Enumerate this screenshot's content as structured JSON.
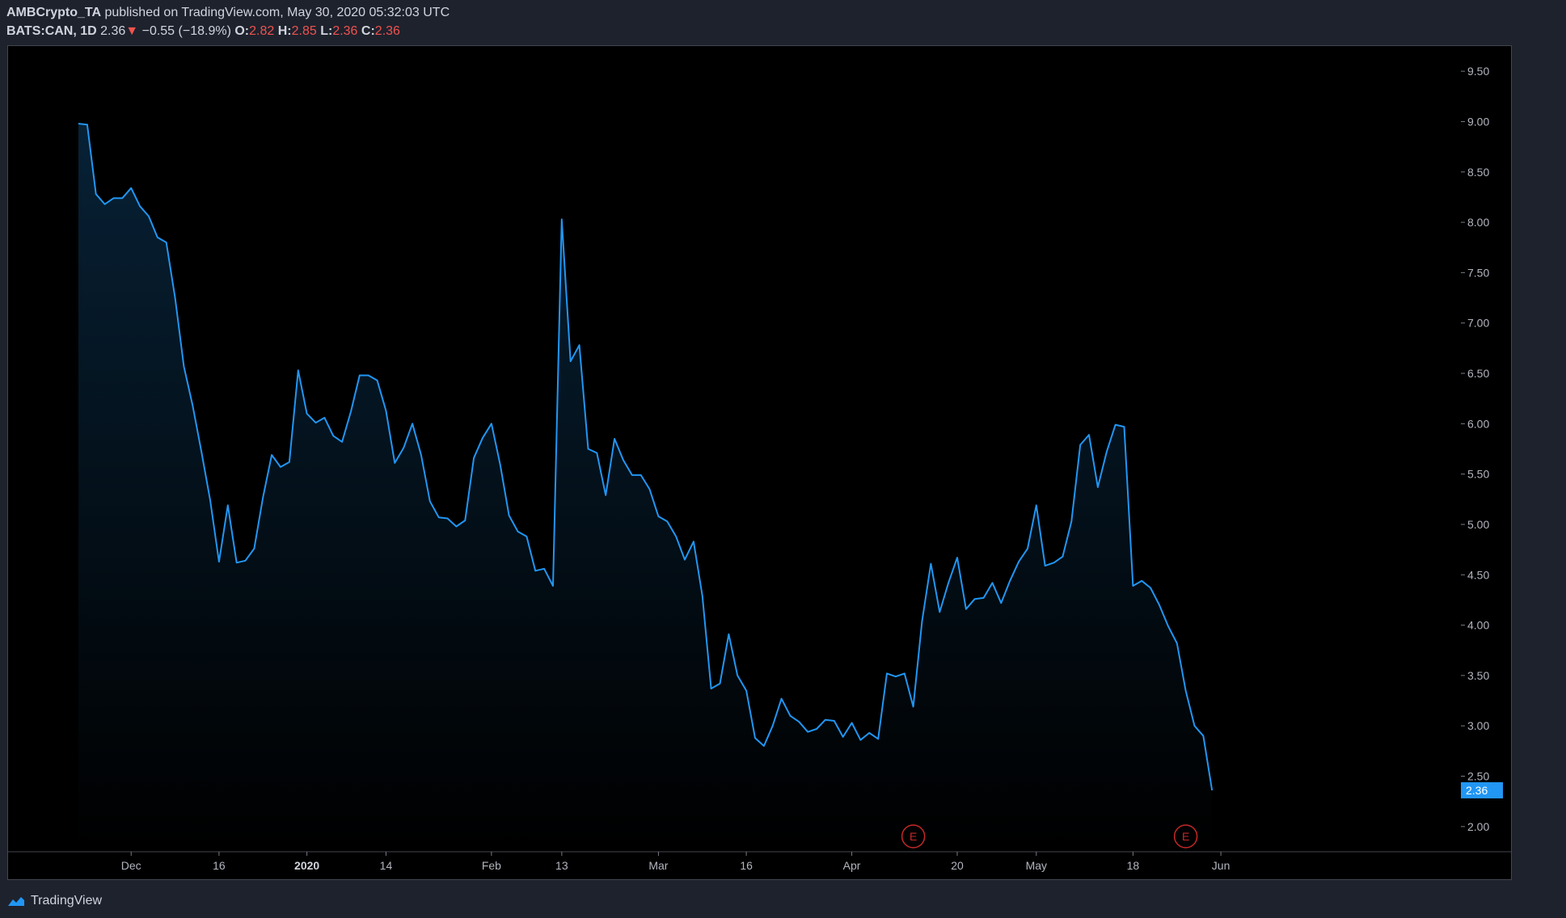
{
  "header": {
    "author": "AMBCrypto_TA",
    "published_text": "published on TradingView.com, May 30, 2020 05:32:03 UTC",
    "symbol": "BATS:CAN, 1D",
    "last_price": "2.36",
    "down_arrow": "▼",
    "change": "−0.55 (−18.9%)",
    "open_label": "O:",
    "open_value": "2.82",
    "high_label": "H:",
    "high_value": "2.85",
    "low_label": "L:",
    "low_value": "2.36",
    "close_label": "C:",
    "close_value": "2.36"
  },
  "footer": {
    "brand": "TradingView"
  },
  "colors": {
    "line": "#2196f3",
    "negative": "#ef5350",
    "earnings": "#c62828",
    "price_tag": "#2196f3",
    "axis_text": "#b2b5be",
    "background": "#000000"
  },
  "chart_data": {
    "type": "area",
    "ylim": [
      1.75,
      9.75
    ],
    "y_ticks": [
      "9.50",
      "9.00",
      "8.50",
      "8.00",
      "7.50",
      "7.00",
      "6.50",
      "6.00",
      "5.50",
      "5.00",
      "4.50",
      "4.00",
      "3.50",
      "3.00",
      "2.50",
      "2.00"
    ],
    "x_ticks": [
      {
        "label": "Dec",
        "index": 6,
        "bold": false
      },
      {
        "label": "16",
        "index": 16,
        "bold": false
      },
      {
        "label": "2020",
        "index": 26,
        "bold": true
      },
      {
        "label": "14",
        "index": 35,
        "bold": false
      },
      {
        "label": "Feb",
        "index": 47,
        "bold": false
      },
      {
        "label": "13",
        "index": 55,
        "bold": false
      },
      {
        "label": "Mar",
        "index": 66,
        "bold": false
      },
      {
        "label": "16",
        "index": 76,
        "bold": false
      },
      {
        "label": "Apr",
        "index": 88,
        "bold": false
      },
      {
        "label": "20",
        "index": 100,
        "bold": false
      },
      {
        "label": "May",
        "index": 109,
        "bold": false
      },
      {
        "label": "18",
        "index": 120,
        "bold": false
      },
      {
        "label": "Jun",
        "index": 130,
        "bold": false
      }
    ],
    "values": [
      8.98,
      8.97,
      8.28,
      8.18,
      8.24,
      8.24,
      8.34,
      8.16,
      8.06,
      7.85,
      7.8,
      7.25,
      6.57,
      6.18,
      5.72,
      5.24,
      4.63,
      5.19,
      4.62,
      4.64,
      4.76,
      5.27,
      5.69,
      5.57,
      5.62,
      6.53,
      6.1,
      6.01,
      6.06,
      5.88,
      5.82,
      6.12,
      6.48,
      6.48,
      6.43,
      6.13,
      5.61,
      5.76,
      6.0,
      5.69,
      5.23,
      5.07,
      5.06,
      4.98,
      5.04,
      5.66,
      5.86,
      6.0,
      5.59,
      5.09,
      4.93,
      4.88,
      4.54,
      4.56,
      4.39,
      8.03,
      6.62,
      6.78,
      5.75,
      5.71,
      5.29,
      5.85,
      5.64,
      5.49,
      5.49,
      5.35,
      5.08,
      5.03,
      4.88,
      4.65,
      4.83,
      4.29,
      3.37,
      3.42,
      3.91,
      3.5,
      3.35,
      2.88,
      2.8,
      3.0,
      3.27,
      3.1,
      3.04,
      2.94,
      2.97,
      3.06,
      3.05,
      2.89,
      3.03,
      2.86,
      2.93,
      2.87,
      3.52,
      3.49,
      3.52,
      3.19,
      4.04,
      4.61,
      4.13,
      4.42,
      4.67,
      4.16,
      4.26,
      4.27,
      4.42,
      4.22,
      4.44,
      4.63,
      4.76,
      5.19,
      4.59,
      4.62,
      4.68,
      5.03,
      5.79,
      5.89,
      5.37,
      5.72,
      5.99,
      5.97,
      4.39,
      4.44,
      4.37,
      4.2,
      3.99,
      3.82,
      3.35,
      3.0,
      2.9,
      2.36
    ],
    "last_value_label": "2.36",
    "earnings_markers": [
      {
        "index": 95,
        "label": "E"
      },
      {
        "index": 126,
        "label": "E"
      }
    ]
  }
}
